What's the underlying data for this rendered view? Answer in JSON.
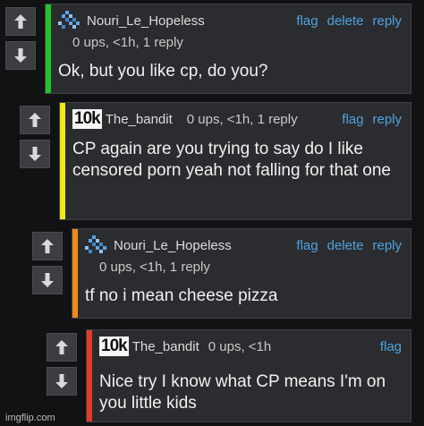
{
  "comments": [
    {
      "username": "Nouri_Le_Hopeless",
      "meta": "0 ups, <1h, 1 reply",
      "actions": [
        "flag",
        "delete",
        "reply"
      ],
      "text": "Ok, but you like cp, do you?",
      "bar_color": "#21c42d",
      "avatar": "pixel-avatar-icon"
    },
    {
      "username": "The_bandit",
      "badge": "10k",
      "meta": "0 ups, <1h, 1 reply",
      "actions": [
        "flag",
        "reply"
      ],
      "text": "CP again are you trying to say do I like censored porn yeah not falling for that one",
      "bar_color": "#f2e61a"
    },
    {
      "username": "Nouri_Le_Hopeless",
      "meta": "0 ups, <1h, 1 reply",
      "actions": [
        "flag",
        "delete",
        "reply"
      ],
      "text": "tf no i mean cheese pizza",
      "bar_color": "#f08a16",
      "avatar": "pixel-avatar-icon"
    },
    {
      "username": "The_bandit",
      "badge": "10k",
      "meta": "0 ups, <1h",
      "actions": [
        "flag"
      ],
      "text": "Nice try I know what CP means I'm on you little kids",
      "bar_color": "#e33a2d"
    }
  ],
  "watermark": "imgflip.com",
  "colors": {
    "link": "#4fa3e0",
    "background": "#111214",
    "card": "#2b2c2f"
  }
}
